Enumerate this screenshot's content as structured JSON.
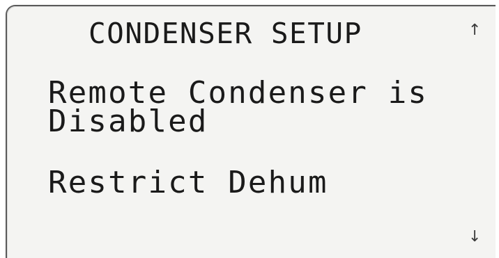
{
  "screen": {
    "title": "CONDENSER SETUP",
    "lines": [
      "Remote Condenser is",
      "Disabled",
      "Restrict Dehum"
    ],
    "scroll_up_icon": "up-arrow-icon",
    "scroll_down_icon": "down-arrow-icon",
    "scroll_up_glyph": "↑",
    "scroll_down_glyph": "↓"
  }
}
